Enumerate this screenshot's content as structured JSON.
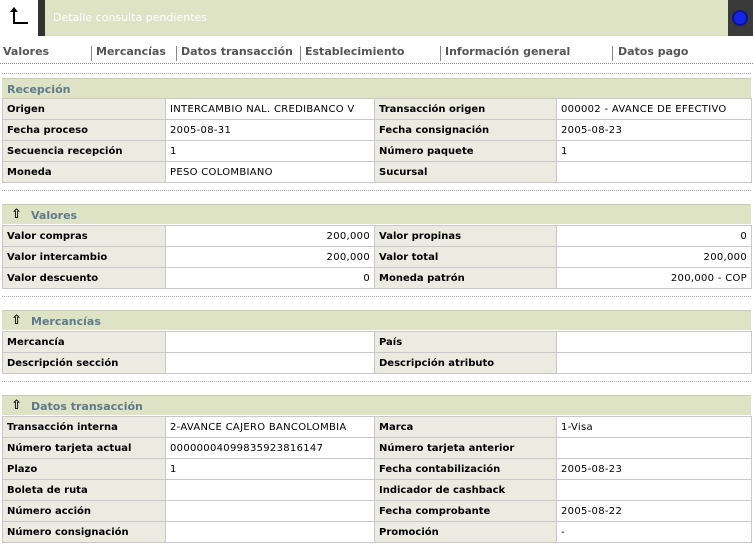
{
  "window": {
    "title": "Detalle consulta pendientes"
  },
  "tabs": [
    {
      "label": "Valores"
    },
    {
      "label": "Mercancías"
    },
    {
      "label": "Datos transacción"
    },
    {
      "label": "Establecimiento"
    },
    {
      "label": "Información general"
    },
    {
      "label": "Datos pago"
    }
  ],
  "recepcion": {
    "title": "Recepción",
    "rows": [
      {
        "l1": "Origen",
        "v1": "INTERCAMBIO NAL. CREDIBANCO V",
        "l2": "Transacción origen",
        "v2": "000002 - AVANCE DE EFECTIVO"
      },
      {
        "l1": "Fecha proceso",
        "v1": "2005-08-31",
        "l2": "Fecha consignación",
        "v2": "2005-08-23"
      },
      {
        "l1": "Secuencia recepción",
        "v1": "1",
        "l2": "Número paquete",
        "v2": "1"
      },
      {
        "l1": "Moneda",
        "v1": "PESO COLOMBIANO",
        "l2": "Sucursal",
        "v2": ""
      }
    ]
  },
  "valores": {
    "title": "Valores",
    "rows": [
      {
        "l1": "Valor compras",
        "v1": "200,000",
        "l2": "Valor propinas",
        "v2": "0"
      },
      {
        "l1": "Valor intercambio",
        "v1": "200,000",
        "l2": "Valor total",
        "v2": "200,000"
      },
      {
        "l1": "Valor descuento",
        "v1": "0",
        "l2": "Moneda patrón",
        "v2": "200,000 - COP"
      }
    ]
  },
  "mercancias": {
    "title": "Mercancías",
    "rows": [
      {
        "l1": "Mercancía",
        "v1": "",
        "l2": "País",
        "v2": ""
      },
      {
        "l1": "Descripción sección",
        "v1": "",
        "l2": "Descripción atributo",
        "v2": ""
      }
    ]
  },
  "datos_transaccion": {
    "title": "Datos transacción",
    "rows": [
      {
        "l1": "Transacción interna",
        "v1": "2-AVANCE CAJERO BANCOLOMBIA",
        "l2": "Marca",
        "v2": "1-Visa"
      },
      {
        "l1": "Número tarjeta actual",
        "v1": "0000000409983592381614​7",
        "l2": "Número tarjeta anterior",
        "v2": ""
      },
      {
        "l1": "Plazo",
        "v1": "1",
        "l2": "Fecha contabilización",
        "v2": "2005-08-23"
      },
      {
        "l1": "Boleta de ruta",
        "v1": "",
        "l2": "Indicador de cashback",
        "v2": ""
      },
      {
        "l1": "Número acción",
        "v1": "",
        "l2": "Fecha comprobante",
        "v2": "2005-08-22"
      },
      {
        "l1": "Número consignación",
        "v1": "",
        "l2": "Promoción",
        "v2": "-"
      }
    ]
  },
  "icons": {
    "back": "corner-up-arrow-icon",
    "status": "blue-dot-icon",
    "collapse": "up-arrow-icon"
  }
}
